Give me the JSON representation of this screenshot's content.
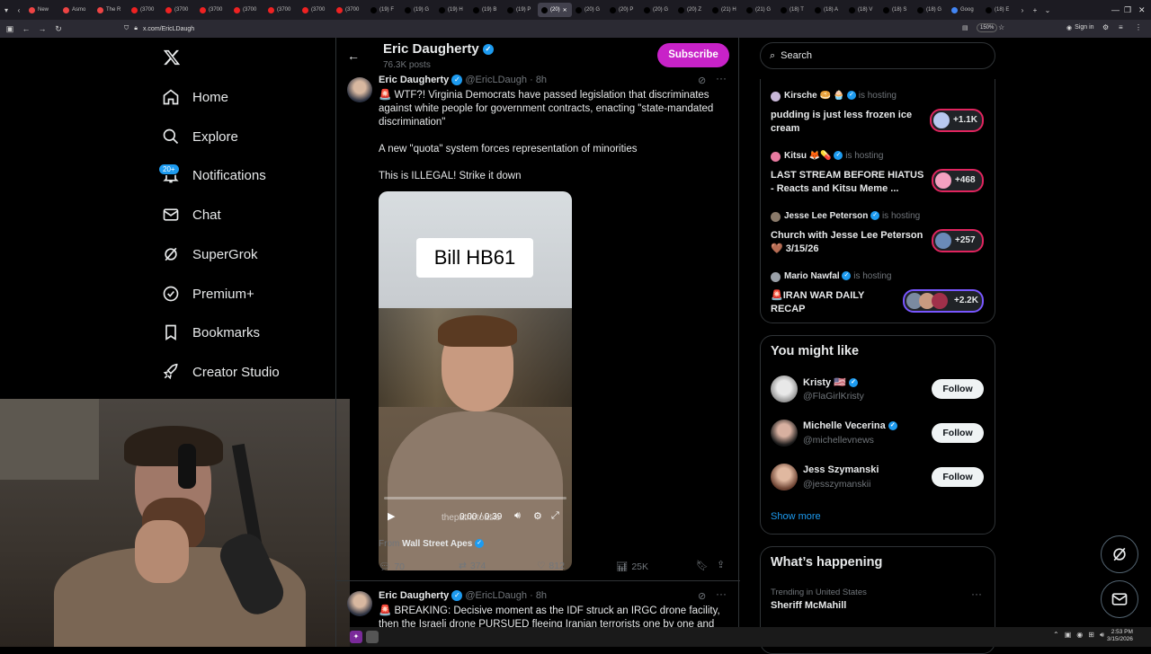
{
  "browser": {
    "tabs": [
      {
        "label": "New",
        "color": "#e44"
      },
      {
        "label": "Asmo",
        "color": "#e44"
      },
      {
        "label": "The R",
        "color": "#e44"
      },
      {
        "label": "(3700",
        "color": "#e22"
      },
      {
        "label": "(3700",
        "color": "#e22"
      },
      {
        "label": "(3700",
        "color": "#e22"
      },
      {
        "label": "(3700",
        "color": "#e22"
      },
      {
        "label": "(3700",
        "color": "#e22"
      },
      {
        "label": "(3700",
        "color": "#e22"
      },
      {
        "label": "(3700",
        "color": "#e22"
      },
      {
        "label": "(19) F",
        "color": "#000"
      },
      {
        "label": "(19) G",
        "color": "#000"
      },
      {
        "label": "(19) H",
        "color": "#000"
      },
      {
        "label": "(19) B",
        "color": "#000"
      },
      {
        "label": "(19) P",
        "color": "#000"
      },
      {
        "label": "(20)",
        "color": "#000",
        "active": true
      },
      {
        "label": "(20) G",
        "color": "#000"
      },
      {
        "label": "(20) P",
        "color": "#000"
      },
      {
        "label": "(20) G",
        "color": "#000"
      },
      {
        "label": "(20) Z",
        "color": "#000"
      },
      {
        "label": "(21) H",
        "color": "#000"
      },
      {
        "label": "(21) G",
        "color": "#000"
      },
      {
        "label": "(18) T",
        "color": "#000"
      },
      {
        "label": "(18) A",
        "color": "#000"
      },
      {
        "label": "(18) V",
        "color": "#000"
      },
      {
        "label": "(18) S",
        "color": "#000"
      },
      {
        "label": "(18) G",
        "color": "#000"
      },
      {
        "label": "Goog",
        "color": "#4285f4"
      },
      {
        "label": "(18) E",
        "color": "#000"
      }
    ],
    "url": "x.com/EricLDaugh",
    "zoom": "150%",
    "sign_in": "Sign in"
  },
  "nav": {
    "items": [
      {
        "label": "Home",
        "icon": "home-icon"
      },
      {
        "label": "Explore",
        "icon": "search-icon"
      },
      {
        "label": "Notifications",
        "icon": "bell-icon",
        "badge": "20+"
      },
      {
        "label": "Chat",
        "icon": "mail-icon"
      },
      {
        "label": "SuperGrok",
        "icon": "grok-icon"
      },
      {
        "label": "Premium+",
        "icon": "premium-icon"
      },
      {
        "label": "Bookmarks",
        "icon": "bookmark-icon"
      },
      {
        "label": "Creator Studio",
        "icon": "rocket-icon"
      }
    ]
  },
  "profile": {
    "name": "Eric Daugherty",
    "posts": "76.3K posts",
    "subscribe": "Subscribe"
  },
  "tweet1": {
    "name": "Eric Daugherty",
    "handle": "@EricLDaugh",
    "time": "· 8h",
    "line1": "🚨 WTF?! Virginia Democrats have passed legislation that discriminates against white people for government contracts, enacting \"state-mandated discrimination\"",
    "line2": "A new \"quota\" system forces representation of minorities",
    "line3": "This is ILLEGAL! Strike it down",
    "video_caption": "Bill HB61",
    "video_watermark": "thepatriotoasis",
    "video_time": "0:00 / 0:39",
    "from_label": "From",
    "from_source": "Wall Street Apes",
    "replies": "70",
    "reposts": "374",
    "likes": "812",
    "views": "25K"
  },
  "tweet2": {
    "name": "Eric Daugherty",
    "handle": "@EricLDaugh",
    "time": "· 8h",
    "line1": "🚨 BREAKING: Decisive moment as the IDF struck an IRGC drone facility, then the Israeli drone PURSUED fleeing Iranian terrorists one by one and"
  },
  "search": {
    "placeholder": "Search"
  },
  "spaces": [
    {
      "host": "Kirsche 🥯 🧁",
      "hosting": "is hosting",
      "title": "pudding is just less frozen ice cream",
      "count": "+1.1K"
    },
    {
      "host": "Kitsu 🦊💊",
      "hosting": "is hosting",
      "title": "LAST STREAM BEFORE HIATUS - Reacts and Kitsu Meme ...",
      "count": "+468"
    },
    {
      "host": "Jesse Lee Peterson",
      "hosting": "is hosting",
      "title": "Church with Jesse Lee Peterson 🤎 3/15/26",
      "count": "+257"
    },
    {
      "host": "Mario Nawfal",
      "hosting": "is hosting",
      "title": "🚨IRAN WAR DAILY RECAP",
      "count": "+2.2K"
    }
  ],
  "you_might_like": {
    "title": "You might like",
    "users": [
      {
        "name": "Kristy 🇺🇸",
        "handle": "@FlaGirlKristy",
        "follow": "Follow"
      },
      {
        "name": "Michelle Vecerina",
        "handle": "@michellevnews",
        "follow": "Follow"
      },
      {
        "name": "Jess Szymanski",
        "handle": "@jesszymanskii",
        "follow": "Follow"
      }
    ],
    "show_more": "Show more"
  },
  "whats_happening": {
    "title": "What’s happening",
    "trend_context": "Trending in United States",
    "trend_name": "Sheriff McMahill"
  },
  "taskbar": {
    "time": "2:53 PM",
    "date": "3/15/2026"
  },
  "colors": {
    "accent": "#1d9bf0",
    "subscribe": "#c822c8",
    "bg": "#000000",
    "border": "#2f3336"
  }
}
